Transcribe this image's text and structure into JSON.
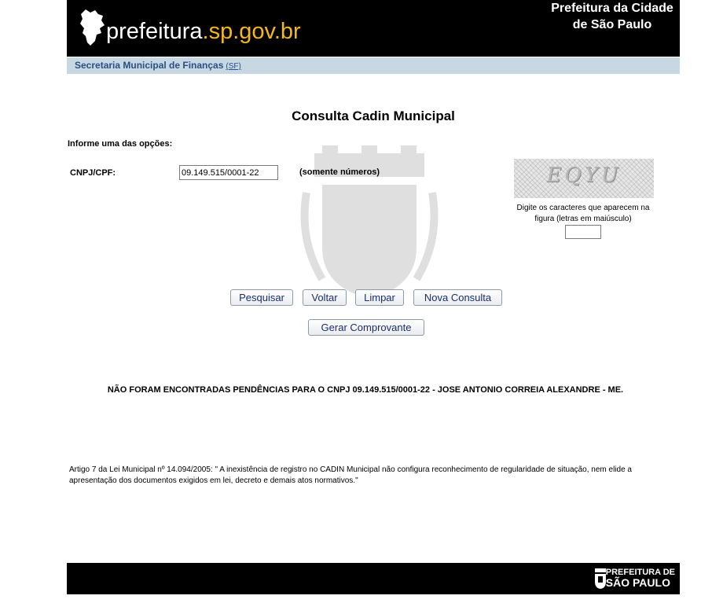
{
  "header": {
    "logo_prefix": "prefeitura",
    "logo_suffix": ".sp.gov.br",
    "city_title": "Prefeitura da Cidade de São Paulo",
    "brand_colors": {
      "background": "#000000",
      "accent": "#f4b71c"
    }
  },
  "subbar": {
    "dept_name": "Secretaria Municipal de Finanças",
    "dept_abbr": "(SF)"
  },
  "form": {
    "title": "Consulta Cadin Municipal",
    "instructions": "Informe uma das opções:",
    "cnpj_label": "CNPJ/CPF:",
    "cnpj_value": "09.149.515/0001-22",
    "cnpj_hint": "(somente números)",
    "captcha_text": "EQYU",
    "captcha_caption": "Digite os caracteres que aparecem na figura (letras em maiúsculo)",
    "captcha_value": ""
  },
  "buttons": {
    "pesquisar": "Pesquisar",
    "voltar": "Voltar",
    "limpar": "Limpar",
    "nova_consulta": "Nova Consulta",
    "gerar_comprovante": "Gerar Comprovante"
  },
  "result": {
    "message": "NÃO FORAM ENCONTRADAS PENDÊNCIAS PARA O CNPJ 09.149.515/0001-22 - JOSE ANTONIO CORREIA ALEXANDRE - ME."
  },
  "legal": {
    "text": "Artigo 7 da Lei Municipal nº 14.094/2005: \" A inexistência de registro no CADIN Municipal não configura reconhecimento de regularidade de situação, nem elide a apresentação dos documentos exigidos em lei, decreto e demais atos normativos.\""
  },
  "footer": {
    "line1": "PREFEITURA DE",
    "line2": "SÃO PAULO"
  }
}
